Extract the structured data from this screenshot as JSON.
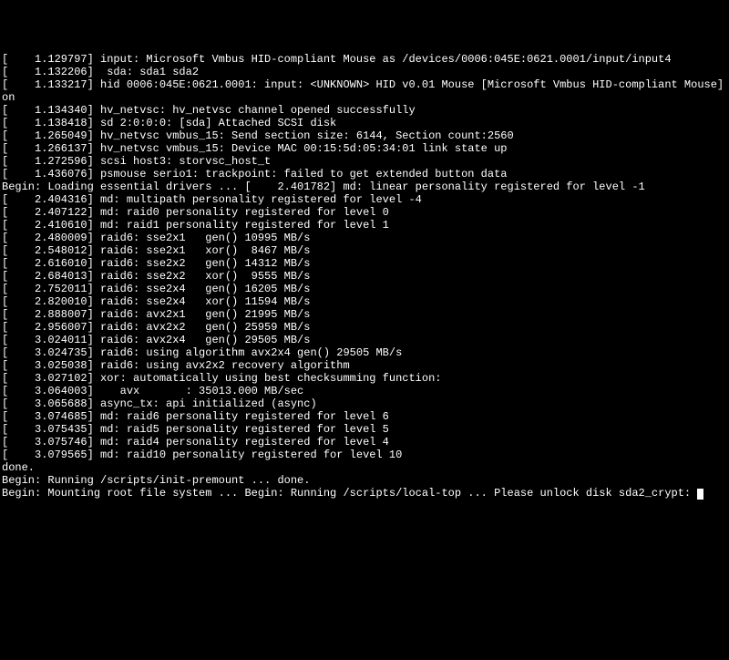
{
  "colors": {
    "bg": "#000000",
    "fg": "#ffffff"
  },
  "lines": [
    "[    1.129797] input: Microsoft Vmbus HID-compliant Mouse as /devices/0006:045E:0621.0001/input/input4",
    "[    1.132206]  sda: sda1 sda2",
    "[    1.133217] hid 0006:045E:0621.0001: input: <UNKNOWN> HID v0.01 Mouse [Microsoft Vmbus HID-compliant Mouse] on",
    "[    1.134340] hv_netvsc: hv_netvsc channel opened successfully",
    "[    1.138418] sd 2:0:0:0: [sda] Attached SCSI disk",
    "[    1.265049] hv_netvsc vmbus_15: Send section size: 6144, Section count:2560",
    "[    1.266137] hv_netvsc vmbus_15: Device MAC 00:15:5d:05:34:01 link state up",
    "[    1.272596] scsi host3: storvsc_host_t",
    "[    1.436076] psmouse serio1: trackpoint: failed to get extended button data",
    "Begin: Loading essential drivers ... [    2.401782] md: linear personality registered for level -1",
    "[    2.404316] md: multipath personality registered for level -4",
    "[    2.407122] md: raid0 personality registered for level 0",
    "[    2.410610] md: raid1 personality registered for level 1",
    "[    2.480009] raid6: sse2x1   gen() 10995 MB/s",
    "[    2.548012] raid6: sse2x1   xor()  8467 MB/s",
    "[    2.616010] raid6: sse2x2   gen() 14312 MB/s",
    "[    2.684013] raid6: sse2x2   xor()  9555 MB/s",
    "[    2.752011] raid6: sse2x4   gen() 16205 MB/s",
    "[    2.820010] raid6: sse2x4   xor() 11594 MB/s",
    "[    2.888007] raid6: avx2x1   gen() 21995 MB/s",
    "[    2.956007] raid6: avx2x2   gen() 25959 MB/s",
    "[    3.024011] raid6: avx2x4   gen() 29505 MB/s",
    "[    3.024735] raid6: using algorithm avx2x4 gen() 29505 MB/s",
    "[    3.025038] raid6: using avx2x2 recovery algorithm",
    "[    3.027102] xor: automatically using best checksumming function:",
    "[    3.064003]    avx       : 35013.000 MB/sec",
    "[    3.065688] async_tx: api initialized (async)",
    "[    3.074685] md: raid6 personality registered for level 6",
    "[    3.075435] md: raid5 personality registered for level 5",
    "[    3.075746] md: raid4 personality registered for level 4",
    "[    3.079565] md: raid10 personality registered for level 10",
    "done.",
    "Begin: Running /scripts/init-premount ... done.",
    "Begin: Mounting root file system ... Begin: Running /scripts/local-top ... Please unlock disk sda2_crypt: "
  ],
  "prompt": {
    "cursor": true
  }
}
